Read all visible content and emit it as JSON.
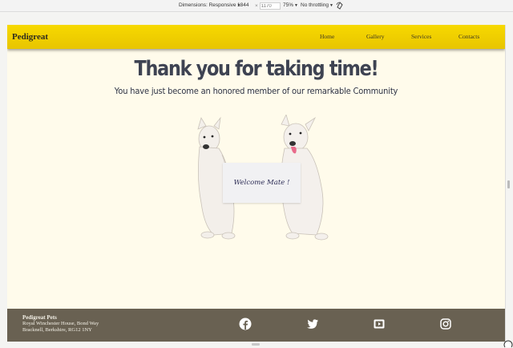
{
  "devtools": {
    "dimensions_label": "Dimensions: Responsive",
    "width": "1844",
    "height_placeholder": "1170",
    "zoom": "75%",
    "throttling": "No throttling"
  },
  "nav": {
    "brand": "Pedigreat",
    "links": [
      "Home",
      "Gallery",
      "Services",
      "Contacts"
    ]
  },
  "hero": {
    "headline": "Thank you for taking time!",
    "subline": "You have just become an honored member of our remarkable Community",
    "sign_text": "Welcome Mate !"
  },
  "footer": {
    "company": "Pedigreat Pets",
    "address_line1": "Royal Winchester House, Bond Way",
    "address_line2": "Bracknell, Berkshire, RG12 1NY",
    "social": [
      "facebook-icon",
      "twitter-icon",
      "youtube-icon",
      "instagram-icon"
    ]
  },
  "colors": {
    "nav_bg": "#f2d300",
    "page_bg": "#fffbeb",
    "headline": "#3e4352",
    "footer_bg": "#696152"
  }
}
